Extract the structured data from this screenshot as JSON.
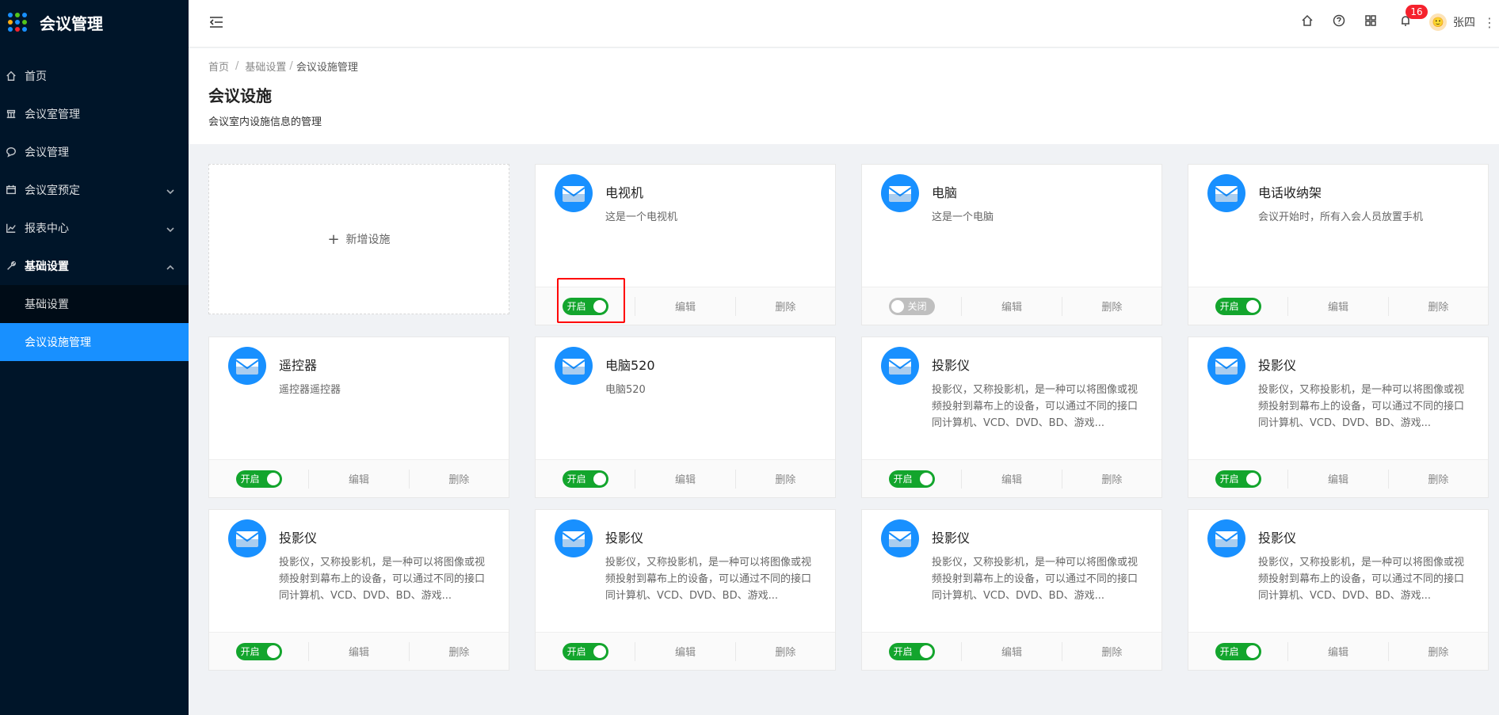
{
  "app": {
    "title": "会议管理"
  },
  "sidebar": {
    "items": [
      {
        "label": "首页",
        "icon": "home-icon"
      },
      {
        "label": "会议室管理",
        "icon": "room-icon"
      },
      {
        "label": "会议管理",
        "icon": "chat-icon"
      },
      {
        "label": "会议室预定",
        "icon": "calendar-icon",
        "expand": "down"
      },
      {
        "label": "报表中心",
        "icon": "chart-icon",
        "expand": "down"
      },
      {
        "label": "基础设置",
        "icon": "wrench-icon",
        "expand": "up"
      }
    ],
    "submenu": [
      {
        "label": "基础设置",
        "active": false
      },
      {
        "label": "会议设施管理",
        "active": true
      }
    ]
  },
  "header": {
    "notifications_count": "16",
    "user_name": "张四",
    "avatar_text": "🙂"
  },
  "breadcrumb": {
    "home": "首页",
    "sep": "/",
    "level2": "基础设置",
    "current": "会议设施管理"
  },
  "page": {
    "title": "会议设施",
    "description": "会议室内设施信息的管理"
  },
  "add_card": {
    "label": "新增设施"
  },
  "actions": {
    "edit": "编辑",
    "delete": "删除"
  },
  "switch_labels": {
    "on": "开启",
    "off": "关闭"
  },
  "cards": [
    {
      "title": "电视机",
      "desc": "这是一个电视机",
      "enabled": true
    },
    {
      "title": "电脑",
      "desc": "这是一个电脑",
      "enabled": false
    },
    {
      "title": "电话收纳架",
      "desc": "会议开始时，所有入会人员放置手机",
      "enabled": true
    },
    {
      "title": "遥控器",
      "desc": "遥控器遥控器",
      "enabled": true
    },
    {
      "title": "电脑520",
      "desc": "电脑520",
      "enabled": true
    },
    {
      "title": "投影仪",
      "desc": "投影仪，又称投影机，是一种可以将图像或视频投射到幕布上的设备，可以通过不同的接口同计算机、VCD、DVD、BD、游戏...",
      "enabled": true
    },
    {
      "title": "投影仪",
      "desc": "投影仪，又称投影机，是一种可以将图像或视频投射到幕布上的设备，可以通过不同的接口同计算机、VCD、DVD、BD、游戏...",
      "enabled": true
    },
    {
      "title": "投影仪",
      "desc": "投影仪，又称投影机，是一种可以将图像或视频投射到幕布上的设备，可以通过不同的接口同计算机、VCD、DVD、BD、游戏...",
      "enabled": true
    },
    {
      "title": "投影仪",
      "desc": "投影仪，又称投影机，是一种可以将图像或视频投射到幕布上的设备，可以通过不同的接口同计算机、VCD、DVD、BD、游戏...",
      "enabled": true
    },
    {
      "title": "投影仪",
      "desc": "投影仪，又称投影机，是一种可以将图像或视频投射到幕布上的设备，可以通过不同的接口同计算机、VCD、DVD、BD、游戏...",
      "enabled": true
    },
    {
      "title": "投影仪",
      "desc": "投影仪，又称投影机，是一种可以将图像或视频投射到幕布上的设备，可以通过不同的接口同计算机、VCD、DVD、BD、游戏...",
      "enabled": true
    }
  ],
  "colors": {
    "accent": "#1890ff",
    "sidebar_bg": "#001529",
    "switch_on": "#13a52d",
    "highlight": "#ff0000"
  }
}
